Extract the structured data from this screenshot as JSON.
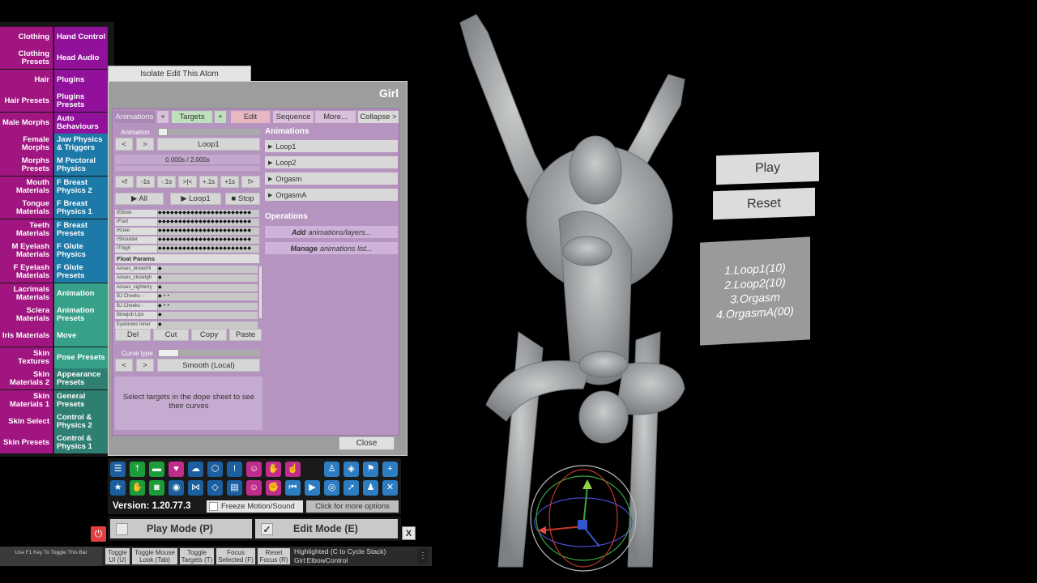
{
  "left_tabs": [
    {
      "left": "Clothing",
      "right": "Hand Control",
      "rcolor": "purple"
    },
    {
      "left": "Clothing Presets",
      "right": "Head Audio",
      "rcolor": "purple"
    },
    {
      "left": "Hair",
      "right": "Plugins",
      "rcolor": "purple"
    },
    {
      "left": "Hair Presets",
      "right": "Plugins Presets",
      "rcolor": "purple"
    },
    {
      "left": "Male Morphs",
      "right": "Auto Behaviours",
      "rcolor": "purple"
    },
    {
      "left": "Female Morphs",
      "right": "Jaw Physics & Triggers",
      "rcolor": "blue"
    },
    {
      "left": "Morphs Presets",
      "right": "M Pectoral Physics",
      "rcolor": "blue"
    },
    {
      "left": "Mouth Materials",
      "right": "F Breast Physics 2",
      "rcolor": "blue"
    },
    {
      "left": "Tongue Materials",
      "right": "F Breast Physics 1",
      "rcolor": "blue"
    },
    {
      "left": "Teeth Materials",
      "right": "F Breast Presets",
      "rcolor": "blue"
    },
    {
      "left": "M Eyelash Materials",
      "right": "F Glute Physics",
      "rcolor": "blue"
    },
    {
      "left": "F Eyelash Materials",
      "right": "F Glute Presets",
      "rcolor": "blue"
    },
    {
      "left": "Lacrimals Materials",
      "right": "Animation",
      "rcolor": "teal"
    },
    {
      "left": "Sclera Materials",
      "right": "Animation Presets",
      "rcolor": "teal"
    },
    {
      "left": "Iris Materials",
      "right": "Move",
      "rcolor": "teal"
    },
    {
      "left": "Skin Textures",
      "right": "Pose Presets",
      "rcolor": "teal"
    },
    {
      "left": "Skin Materials 2",
      "right": "Appearance Presets",
      "rcolor": "dteal"
    },
    {
      "left": "Skin Materials 1",
      "right": "General Presets",
      "rcolor": "dteal"
    },
    {
      "left": "Skin Select",
      "right": "Control & Physics 2",
      "rcolor": "dteal"
    },
    {
      "left": "Skin Presets",
      "right": "Control & Physics 1",
      "rcolor": "dteal"
    }
  ],
  "isolate_label": "Isolate Edit This Atom",
  "panel_title": "Girl",
  "header_buttons": {
    "animations": "Animations",
    "plus1": "+",
    "targets": "Targets",
    "plus2": "+",
    "edit": "Edit",
    "sequence": "Sequence",
    "more": "More...",
    "collapse": "Collapse >"
  },
  "animation_label": "Animation",
  "nav": {
    "prev": "<",
    "next": ">",
    "current": "Loop1"
  },
  "time_display": "0.000s / 2.000s",
  "step_buttons": [
    "<f",
    "-1s",
    "-.1s",
    ">|<",
    "+.1s",
    "+1s",
    "f>"
  ],
  "play_all": "▶ All",
  "play_loop": "▶ Loop1",
  "stop": "■ Stop",
  "dope_targets": [
    {
      "label": "rElbow",
      "keys": "◆◆◆◆◆◆◆◆◆◆◆◆◆◆◆◆◆◆◆◆◆◆◆"
    },
    {
      "label": "rFoot",
      "keys": "◆◆◆◆◆◆◆◆◆◆◆◆◆◆◆◆◆◆◆◆◆◆◆"
    },
    {
      "label": "rKnee",
      "keys": "◆◆◆◆◆◆◆◆◆◆◆◆◆◆◆◆◆◆◆◆◆◆◆"
    },
    {
      "label": "rShoulder",
      "keys": "◆◆◆◆◆◆◆◆◆◆◆◆◆◆◆◆◆◆◆◆◆◆◆"
    },
    {
      "label": "rThigh",
      "keys": "◆◆◆◆◆◆◆◆◆◆◆◆◆◆◆◆◆◆◆◆◆◆◆"
    }
  ],
  "float_params_label": "Float Params",
  "float_params": [
    {
      "label": "AAsex_browsHi",
      "keys": "◆"
    },
    {
      "label": "AAsex_closeIgh",
      "keys": "◆"
    },
    {
      "label": "AAsex_sighterry",
      "keys": "◆"
    },
    {
      "label": "BJ Cheeks -",
      "keys": "◆       •                  •"
    },
    {
      "label": "BJ Cheeks -",
      "keys": "◆       •                  •"
    },
    {
      "label": "Blowjob Lips",
      "keys": "◆"
    },
    {
      "label": "Eyebrows Inner",
      "keys": "◆"
    }
  ],
  "edit_buttons": {
    "del": "Del",
    "cut": "Cut",
    "copy": "Copy",
    "paste": "Paste"
  },
  "curve_type_label": "Curve type",
  "curve_nav": {
    "prev": "<",
    "next": ">",
    "current": "Smooth (Local)"
  },
  "hint": "Select targets in the dope sheet to see their curves",
  "animations_header": "Animations",
  "animations_list": [
    "Loop1",
    "Loop2",
    "Orgasm",
    "OrgasmA"
  ],
  "operations_header": "Operations",
  "operations": [
    {
      "bold": "Add",
      "rest": "animations/layers..."
    },
    {
      "bold": "Manage",
      "rest": "animations list..."
    }
  ],
  "close_label": "Close",
  "toolbar_icons_row1": [
    "menu-icon",
    "open-scene-icon",
    "folder-icon",
    "like-icon",
    "cloud-upload-icon",
    "package-icon",
    "alert-icon",
    "person-add-icon",
    "hand-icon",
    "pointer-hand-icon",
    "person-icon",
    "unity-icon",
    "flag-icon",
    "plus-icon"
  ],
  "toolbar_icons_row2": [
    "star-icon",
    "hand-open-icon",
    "camera-green-icon",
    "camera-icon",
    "nodes-icon",
    "dropbox-icon",
    "document-icon",
    "person-remove-icon",
    "hand-grab-icon",
    "skip-back-icon",
    "play-icon",
    "target-icon",
    "cursor-icon",
    "group-icon",
    "tools-icon"
  ],
  "version": "Version: 1.20.77.3",
  "freeze_label": "Freeze Motion/Sound",
  "more_options": "Click for more options",
  "play_mode": "Play Mode (P)",
  "edit_mode": "Edit Mode (E)",
  "edit_check": "✓",
  "close_x": "X",
  "f1_hint": "Use F1 Key To Toggle This Bar",
  "bottom_buttons": [
    {
      "label": "Toggle UI (U)"
    },
    {
      "label": "Toggle Mouse Look (Tab)"
    },
    {
      "label": "Toggle Targets (T)"
    },
    {
      "label": "Focus Selected (F)"
    },
    {
      "label": "Reset Focus (R)"
    }
  ],
  "highlight_line1": "Highlighted (C to Cycle Stack)",
  "highlight_line2": "Girl:ElbowControl",
  "scene_play": "Play",
  "scene_reset": "Reset",
  "scene_loops": [
    "1.Loop1(10)",
    "2.Loop2(10)",
    "3.Orgasm",
    "4.OrgasmA(00)"
  ],
  "colors": {
    "tab_left": "#a0157f",
    "purple": "#92119b",
    "blue": "#1d79a8",
    "teal": "#36a088",
    "dteal": "#2e7e72",
    "panel_purple": "#b595c0"
  }
}
